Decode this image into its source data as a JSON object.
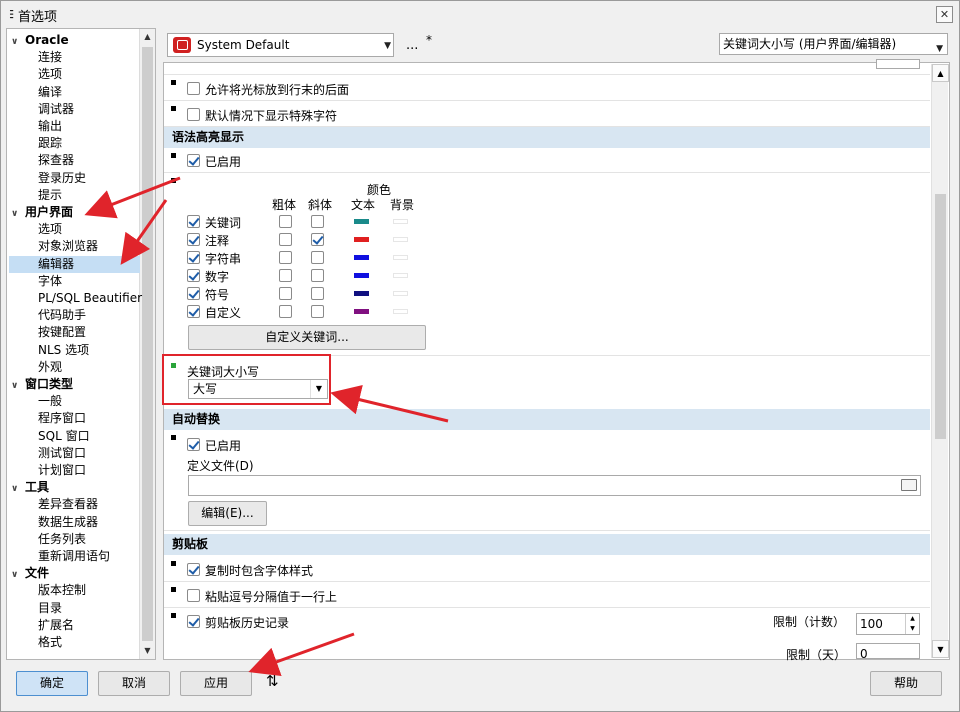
{
  "window": {
    "title": "首选项",
    "close": "✕"
  },
  "tree": {
    "groups": [
      {
        "label": "Oracle",
        "children": [
          "连接",
          "选项",
          "编译",
          "调试器",
          "输出",
          "跟踪",
          "探查器",
          "登录历史",
          "提示"
        ]
      },
      {
        "label": "用户界面",
        "children": [
          "选项",
          "对象浏览器",
          "编辑器",
          "字体",
          "PL/SQL Beautifier",
          "代码助手",
          "按键配置",
          "NLS 选项",
          "外观"
        ]
      },
      {
        "label": "窗口类型",
        "children": [
          "一般",
          "程序窗口",
          "SQL 窗口",
          "测试窗口",
          "计划窗口"
        ]
      },
      {
        "label": "工具",
        "children": [
          "差异查看器",
          "数据生成器",
          "任务列表",
          "重新调用语句"
        ]
      },
      {
        "label": "文件",
        "children": [
          "版本控制",
          "目录",
          "扩展名",
          "格式"
        ]
      }
    ],
    "selected": "编辑器"
  },
  "header": {
    "scheme": "System Default",
    "more": "...",
    "modified": "*",
    "search": "关键词大小写 (用户界面/编辑器)"
  },
  "editor": {
    "opt_cursor_eol": "允许将光标放到行末的后面",
    "opt_special_chars": "默认情况下显示特殊字符",
    "syntax_section": "语法高亮显示",
    "syntax_enabled": "已启用",
    "col_color": "颜色",
    "col_bold": "粗体",
    "col_italic": "斜体",
    "col_text": "文本",
    "col_bg": "背景",
    "syntax_items": [
      {
        "label": "关键词",
        "checked": true,
        "bold": false,
        "italic": false,
        "color": "#1a8a8a"
      },
      {
        "label": "注释",
        "checked": true,
        "bold": false,
        "italic": true,
        "color": "#e02020"
      },
      {
        "label": "字符串",
        "checked": true,
        "bold": false,
        "italic": false,
        "color": "#1010e0"
      },
      {
        "label": "数字",
        "checked": true,
        "bold": false,
        "italic": false,
        "color": "#1010e0"
      },
      {
        "label": "符号",
        "checked": true,
        "bold": false,
        "italic": false,
        "color": "#101080"
      },
      {
        "label": "自定义",
        "checked": true,
        "bold": false,
        "italic": false,
        "color": "#801080"
      }
    ],
    "custom_keywords_btn": "自定义关键词...",
    "keyword_case_label": "关键词大小写",
    "keyword_case_value": "大写",
    "autoreplace_section": "自动替换",
    "autoreplace_enabled": "已启用",
    "def_file_label": "定义文件(D)",
    "def_file_value": "",
    "edit_btn": "编辑(E)...",
    "clipboard_section": "剪贴板",
    "clip_copy_font": "复制时包含字体样式",
    "clip_paste_comma": "粘贴逗号分隔值于一行上",
    "clip_history": "剪贴板历史记录",
    "limit_count_label": "限制（计数）",
    "limit_count_value": "100",
    "limit_days_label": "限制（天）",
    "limit_days_value": "0"
  },
  "footer": {
    "ok": "确定",
    "cancel": "取消",
    "apply": "应用",
    "help": "帮助"
  }
}
